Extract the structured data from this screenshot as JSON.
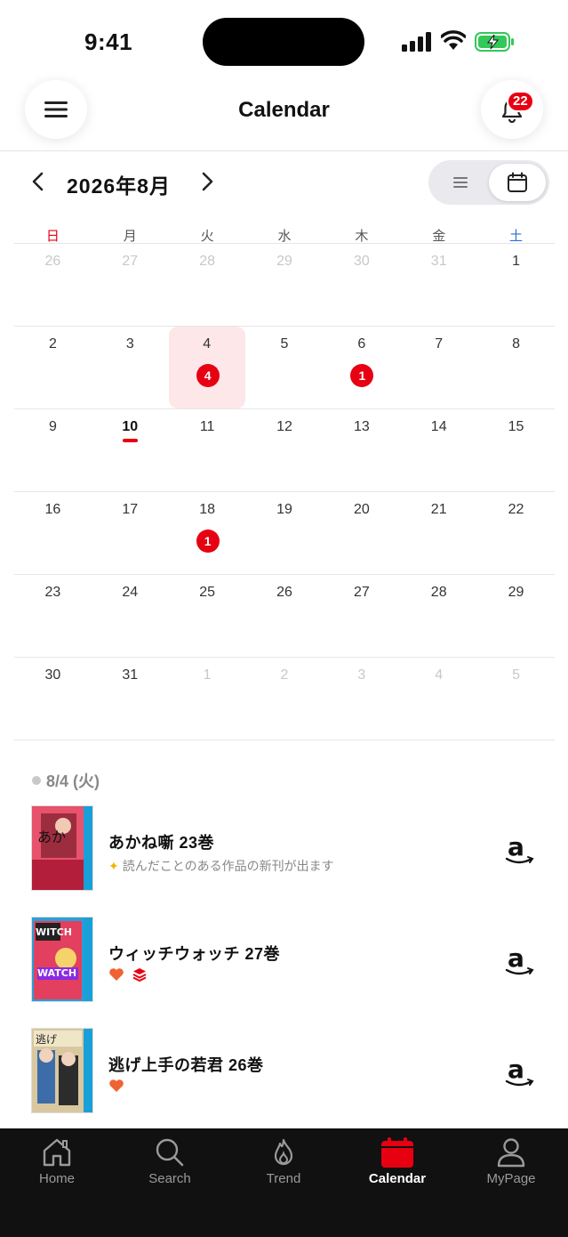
{
  "status_bar": {
    "time": "9:41"
  },
  "header": {
    "title": "Calendar",
    "notification_count": "22"
  },
  "month_nav": {
    "label": "2026年8月"
  },
  "weekdays": [
    "日",
    "月",
    "火",
    "水",
    "木",
    "金",
    "土"
  ],
  "calendar": {
    "weeks": [
      [
        {
          "d": "26",
          "other": true
        },
        {
          "d": "27",
          "other": true
        },
        {
          "d": "28",
          "other": true
        },
        {
          "d": "29",
          "other": true
        },
        {
          "d": "30",
          "other": true
        },
        {
          "d": "31",
          "other": true
        },
        {
          "d": "1"
        }
      ],
      [
        {
          "d": "2"
        },
        {
          "d": "3"
        },
        {
          "d": "4",
          "selected": true,
          "count": "4"
        },
        {
          "d": "5"
        },
        {
          "d": "6",
          "count": "1"
        },
        {
          "d": "7"
        },
        {
          "d": "8"
        }
      ],
      [
        {
          "d": "9"
        },
        {
          "d": "10",
          "today": true
        },
        {
          "d": "11"
        },
        {
          "d": "12"
        },
        {
          "d": "13"
        },
        {
          "d": "14"
        },
        {
          "d": "15"
        }
      ],
      [
        {
          "d": "16"
        },
        {
          "d": "17"
        },
        {
          "d": "18",
          "count": "1"
        },
        {
          "d": "19"
        },
        {
          "d": "20"
        },
        {
          "d": "21"
        },
        {
          "d": "22"
        }
      ],
      [
        {
          "d": "23"
        },
        {
          "d": "24"
        },
        {
          "d": "25"
        },
        {
          "d": "26"
        },
        {
          "d": "27"
        },
        {
          "d": "28"
        },
        {
          "d": "29"
        }
      ],
      [
        {
          "d": "30"
        },
        {
          "d": "31"
        },
        {
          "d": "1",
          "other": true
        },
        {
          "d": "2",
          "other": true
        },
        {
          "d": "3",
          "other": true
        },
        {
          "d": "4",
          "other": true
        },
        {
          "d": "5",
          "other": true
        }
      ]
    ]
  },
  "release_list": {
    "date_heading": "8/4 (火)",
    "items": [
      {
        "title": "あかね噺 23巻",
        "note": "読んだことのある作品の新刊が出ます",
        "cover_color": "#c8243a"
      },
      {
        "title": "ウィッチウォッチ 27巻",
        "note": "",
        "cover_color": "#2a9fd6"
      },
      {
        "title": "逃げ上手の若君 26巻",
        "note": "",
        "cover_color": "#5a8fb8"
      }
    ]
  },
  "tabbar": {
    "tabs": [
      {
        "label": "Home"
      },
      {
        "label": "Search"
      },
      {
        "label": "Trend"
      },
      {
        "label": "Calendar",
        "active": true
      },
      {
        "label": "MyPage"
      }
    ]
  },
  "colors": {
    "accent": "#e60012",
    "selected_bg": "#fde7e8",
    "tabbar_bg": "#111111"
  }
}
